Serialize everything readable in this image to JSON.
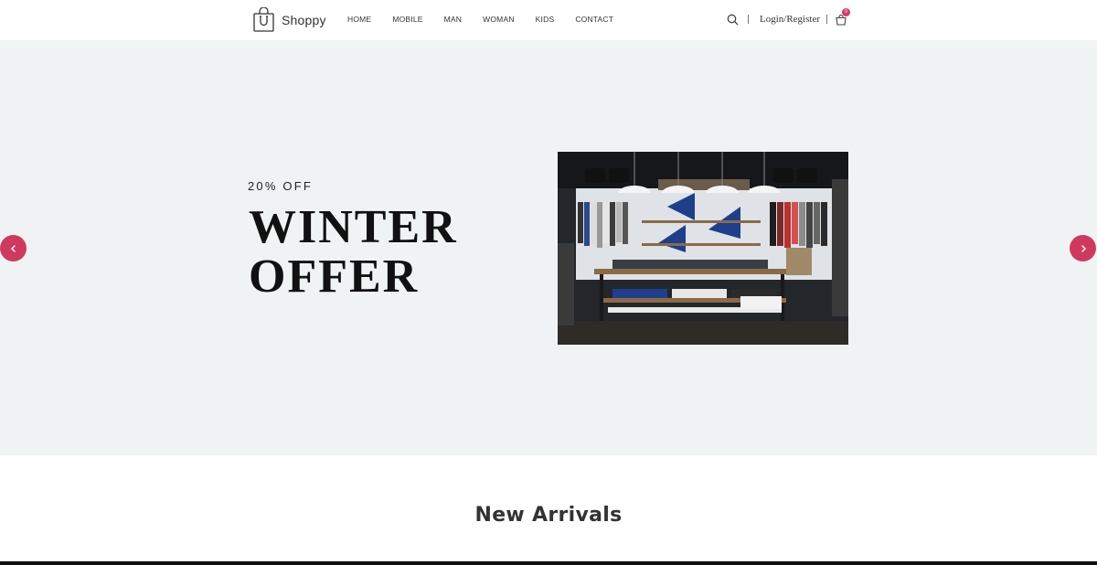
{
  "brand": {
    "name": "Shoppy",
    "accent_color": "#d3386a",
    "logo_icon": "shopping-bag-icon"
  },
  "nav": {
    "items": [
      "HOME",
      "MOBILE",
      "MAN",
      "WOMAN",
      "KIDS",
      "CONTACT"
    ]
  },
  "header": {
    "search_icon": "search-icon",
    "login_label": "Login/Register",
    "cart_icon": "cart-icon",
    "cart_count": "0"
  },
  "hero": {
    "kicker": "20% OFF",
    "title_line1": "WINTER",
    "title_line2": "OFFER",
    "background": "#eff3f3",
    "prev_icon": "chevron-left-icon",
    "next_icon": "chevron-right-icon"
  },
  "section": {
    "title": "New Arrivals"
  }
}
